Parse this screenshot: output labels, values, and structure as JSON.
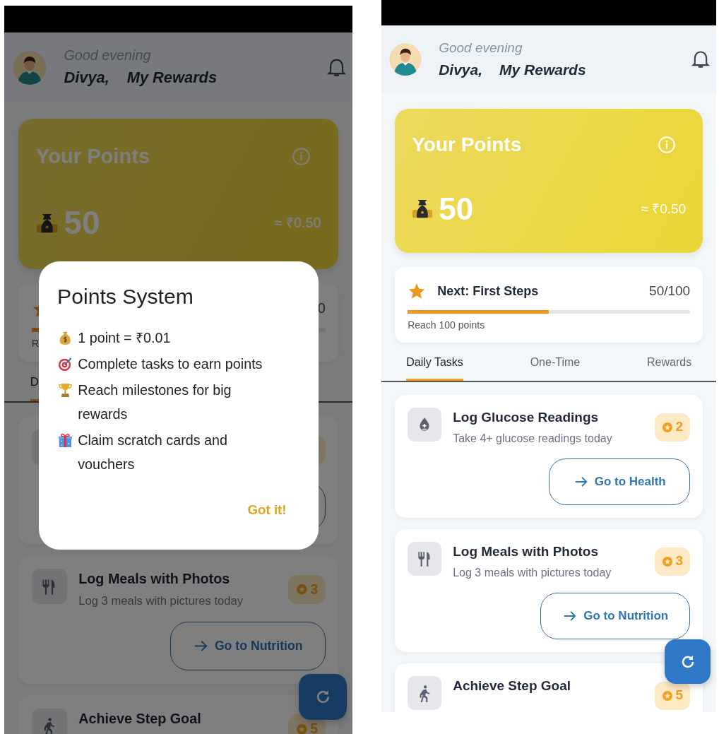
{
  "screens": [
    {
      "kind": "dialog",
      "header": {
        "greeting": "Good evening",
        "name": "Divya,",
        "title": "My Rewards"
      },
      "points_card": {
        "title": "Your Points",
        "points": "50",
        "value": "≈ ₹0.50"
      },
      "milestone": {
        "count": "0",
        "caption": "R",
        "level": 0.5
      },
      "tabs": [
        {
          "label": "D",
          "selected": true
        }
      ],
      "tasks": [
        {
          "kind": "covered"
        },
        {
          "kind": "meal",
          "title": "Log Meals with Photos",
          "subtitle": "Log 3 meals with pictures today",
          "points": "3",
          "action": "Go to Nutrition"
        },
        {
          "kind": "steps",
          "title": "Achieve Step Goal",
          "points": "5"
        }
      ],
      "dialog": {
        "title": "Points System",
        "lines": [
          {
            "kind": "money",
            "text": "1 point = ₹0.01"
          },
          {
            "kind": "target",
            "text": "Complete tasks to earn points"
          },
          {
            "kind": "trophy",
            "text": "Reach milestones for big rewards"
          },
          {
            "kind": "gift",
            "text": "Claim scratch cards and vouchers"
          }
        ],
        "button": "Got it!"
      }
    },
    {
      "kind": "plain",
      "header": {
        "greeting": "Good evening",
        "name": "Divya,",
        "title": "My Rewards"
      },
      "points_card": {
        "title": "Your Points",
        "points": "50",
        "value": "≈ ₹0.50"
      },
      "milestone": {
        "title": "Next: First Steps",
        "count": "50/100",
        "caption": "Reach 100 points",
        "level": 0.5
      },
      "tabs": [
        {
          "label": "Daily Tasks",
          "selected": true
        },
        {
          "label": "One-Time",
          "selected": false
        },
        {
          "label": "Rewards",
          "selected": false
        }
      ],
      "tasks": [
        {
          "kind": "glucose",
          "title": "Log Glucose Readings",
          "subtitle": "Take 4+ glucose readings today",
          "points": "2",
          "action": "Go to Health"
        },
        {
          "kind": "meal",
          "title": "Log Meals with Photos",
          "subtitle": "Log 3 meals with pictures today",
          "points": "3",
          "action": "Go to Nutrition"
        },
        {
          "kind": "steps",
          "title": "Achieve Step Goal",
          "points": "5"
        }
      ]
    }
  ]
}
